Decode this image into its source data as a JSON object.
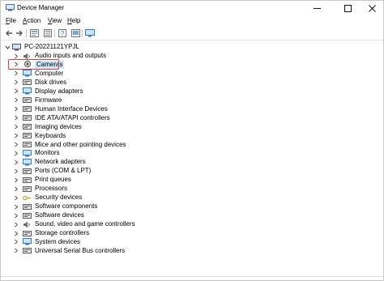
{
  "window": {
    "title": "Device Manager"
  },
  "menu": [
    {
      "pre": "",
      "ul": "F",
      "post": "ile"
    },
    {
      "pre": "",
      "ul": "A",
      "post": "ction"
    },
    {
      "pre": "",
      "ul": "V",
      "post": "iew"
    },
    {
      "pre": "",
      "ul": "H",
      "post": "elp"
    }
  ],
  "toolbar_icons": [
    "back-icon",
    "forward-icon",
    "properties-icon",
    "properties-list-icon",
    "help-icon",
    "update-icon",
    "monitor-icon"
  ],
  "tree": {
    "root_label": "PC-20221121YPJL",
    "items": [
      {
        "label": "Audio inputs and outputs",
        "icon": "speaker-icon",
        "color": "#6b6b6b"
      },
      {
        "label": "Cameras",
        "icon": "camera-icon",
        "color": "#4a4a4a",
        "selected": true
      },
      {
        "label": "Computer",
        "icon": "computer-icon",
        "color": "#2f7fd1"
      },
      {
        "label": "Disk drives",
        "icon": "disk-drive-icon",
        "color": "#5c5c5c"
      },
      {
        "label": "Display adapters",
        "icon": "display-adapter-icon",
        "color": "#2f7fd1"
      },
      {
        "label": "Firmware",
        "icon": "firmware-icon",
        "color": "#5c5c5c"
      },
      {
        "label": "Human Interface Devices",
        "icon": "hid-icon",
        "color": "#5c5c5c"
      },
      {
        "label": "IDE ATA/ATAPI controllers",
        "icon": "ide-controller-icon",
        "color": "#5c5c5c"
      },
      {
        "label": "Imaging devices",
        "icon": "imaging-device-icon",
        "color": "#5c5c5c"
      },
      {
        "label": "Keyboards",
        "icon": "keyboard-icon",
        "color": "#5c5c5c"
      },
      {
        "label": "Mice and other pointing devices",
        "icon": "mouse-icon",
        "color": "#5c5c5c"
      },
      {
        "label": "Monitors",
        "icon": "monitor-icon",
        "color": "#2f7fd1"
      },
      {
        "label": "Network adapters",
        "icon": "network-adapter-icon",
        "color": "#2f7fd1"
      },
      {
        "label": "Ports (COM & LPT)",
        "icon": "port-icon",
        "color": "#5c5c5c"
      },
      {
        "label": "Print queues",
        "icon": "printer-icon",
        "color": "#5c5c5c"
      },
      {
        "label": "Processors",
        "icon": "processor-icon",
        "color": "#5c5c5c"
      },
      {
        "label": "Security devices",
        "icon": "security-device-icon",
        "color": "#c9a227"
      },
      {
        "label": "Software components",
        "icon": "software-component-icon",
        "color": "#5c5c5c"
      },
      {
        "label": "Software devices",
        "icon": "software-device-icon",
        "color": "#5c5c5c"
      },
      {
        "label": "Sound, video and game controllers",
        "icon": "sound-icon",
        "color": "#6b6b6b"
      },
      {
        "label": "Storage controllers",
        "icon": "storage-controller-icon",
        "color": "#5c5c5c"
      },
      {
        "label": "System devices",
        "icon": "system-device-icon",
        "color": "#2f7fd1"
      },
      {
        "label": "Universal Serial Bus controllers",
        "icon": "usb-icon",
        "color": "#5c5c5c"
      }
    ]
  },
  "colors": {
    "highlight_border": "#e53935",
    "selection_bg": "#cce8ff",
    "accent_blue": "#2f7fd1"
  }
}
